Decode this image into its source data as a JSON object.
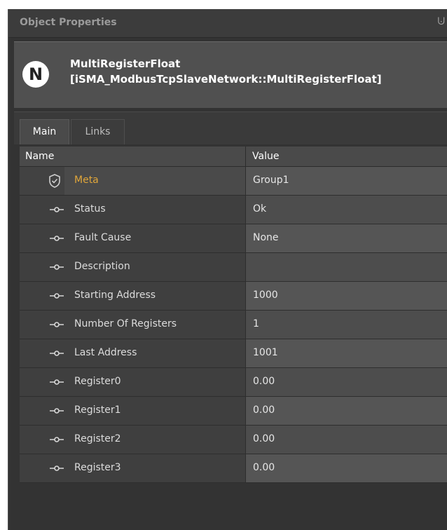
{
  "panel": {
    "title": "Object Properties",
    "pin_glyph": "⨃"
  },
  "object": {
    "badge_letter": "N",
    "name": "MultiRegisterFloat",
    "type": "[iSMA_ModbusTcpSlaveNetwork::MultiRegisterFloat]"
  },
  "tabs": [
    {
      "label": "Main",
      "active": true
    },
    {
      "label": "Links",
      "active": false
    }
  ],
  "grid": {
    "headers": {
      "name": "Name",
      "value": "Value"
    },
    "rows": [
      {
        "icon": "shield-icon",
        "name": "Meta",
        "value": "Group1"
      },
      {
        "icon": "slot-link-icon",
        "name": "Status",
        "value": "Ok"
      },
      {
        "icon": "slot-link-icon",
        "name": "Fault Cause",
        "value": "None"
      },
      {
        "icon": "slot-link-icon",
        "name": "Description",
        "value": ""
      },
      {
        "icon": "slot-link-icon",
        "name": "Starting Address",
        "value": "1000"
      },
      {
        "icon": "slot-link-icon",
        "name": "Number Of Registers",
        "value": "1"
      },
      {
        "icon": "slot-link-icon",
        "name": "Last Address",
        "value": "1001"
      },
      {
        "icon": "slot-link-icon",
        "name": "Register0",
        "value": "0.00"
      },
      {
        "icon": "slot-link-icon",
        "name": "Register1",
        "value": "0.00"
      },
      {
        "icon": "slot-link-icon",
        "name": "Register2",
        "value": "0.00"
      },
      {
        "icon": "slot-link-icon",
        "name": "Register3",
        "value": "0.00"
      }
    ]
  },
  "colors": {
    "meta_label": "#e0a63a",
    "panel_bg": "#333333",
    "header_bg": "#505050"
  }
}
